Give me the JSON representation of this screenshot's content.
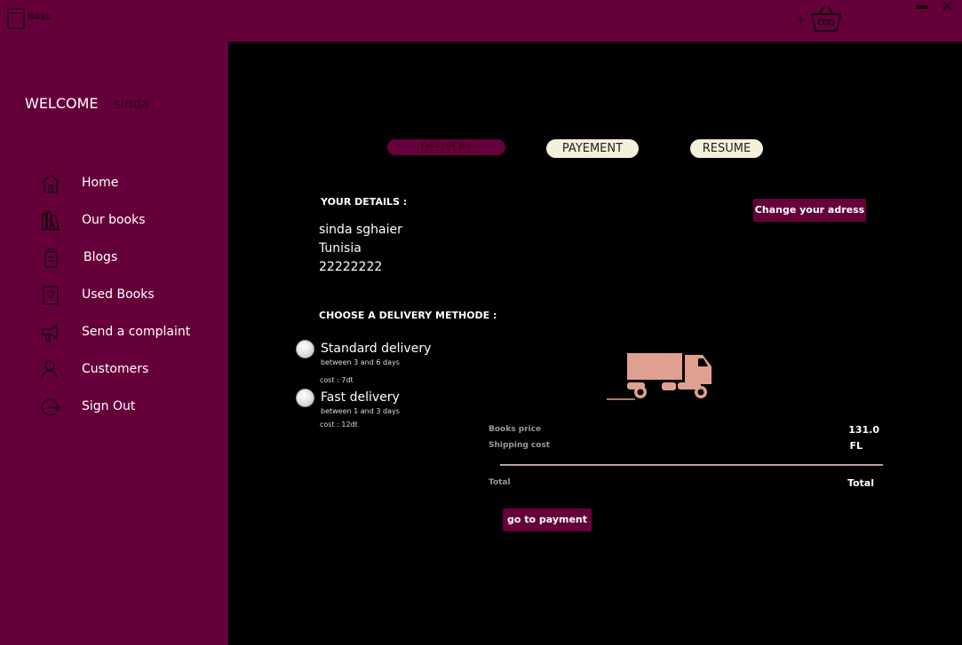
{
  "app": {
    "title": "B8ks"
  },
  "header": {
    "cart_count": "4",
    "cart_icon": "basket-icon"
  },
  "sidebar": {
    "welcome_label": "WELCOME",
    "username": "sinda",
    "items": [
      {
        "label": "Home",
        "icon": "home-icon"
      },
      {
        "label": "Our books",
        "icon": "books-icon"
      },
      {
        "label": "Blogs",
        "icon": "blog-icon"
      },
      {
        "label": "Used Books",
        "icon": "used-book-icon"
      },
      {
        "label": "Send a complaint",
        "icon": "complaint-icon"
      },
      {
        "label": "Customers",
        "icon": "customers-icon"
      },
      {
        "label": "Sign Out",
        "icon": "sign-out-icon"
      }
    ]
  },
  "steps": {
    "delivery": "DELIVERY",
    "payment": "PAYEMENT",
    "resume": "RESUME",
    "active": "delivery"
  },
  "details": {
    "title": "YOUR DETAILS :",
    "name": "sinda sghaier",
    "country": "Tunisia",
    "phone": "22222222",
    "change_address_label": "Change your adress"
  },
  "delivery": {
    "title": "CHOOSE A DELIVERY METHODE :",
    "options": [
      {
        "label": "Standard delivery",
        "delay": "between 3 and 6 days",
        "cost": "cost : 7dt"
      },
      {
        "label": "Fast delivery",
        "delay": "between 1 and 3 days",
        "cost": "cost : 12dt"
      }
    ]
  },
  "summary": {
    "books_price_label": "Books price",
    "books_price_value": "131.0",
    "shipping_label": "Shipping cost",
    "shipping_value": "FL",
    "total_label": "Total",
    "total_value": "Total"
  },
  "actions": {
    "go_to_payment": "go to payment"
  },
  "colors": {
    "brand": "#66003a",
    "background": "#000000",
    "tab_inactive": "#f6efd9",
    "truck": "#e0a090"
  }
}
